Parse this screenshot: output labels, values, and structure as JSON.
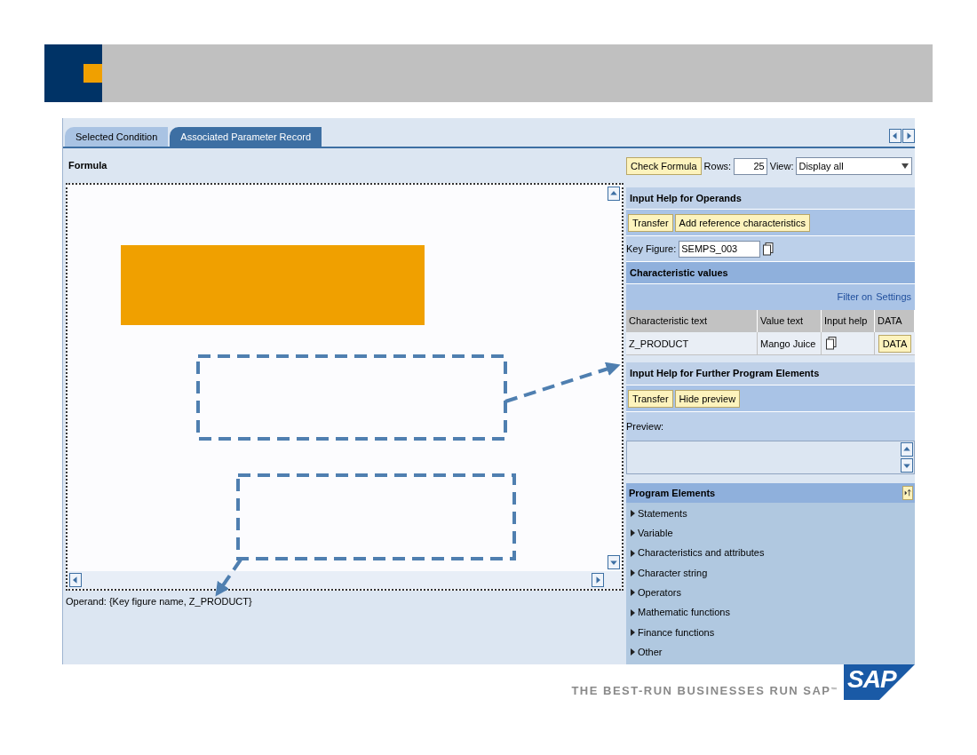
{
  "tabs": [
    {
      "label": "Selected Condition",
      "selected": false
    },
    {
      "label": "Associated Parameter Record",
      "selected": true
    }
  ],
  "formula": {
    "label": "Formula",
    "operand": "Operand: {Key figure name, Z_PRODUCT}"
  },
  "toolbar": {
    "check_button": "Check Formula",
    "rows_label": "Rows:",
    "rows_value": "25",
    "view_label": "View:",
    "view_value": "Display all"
  },
  "operands": {
    "title": "Input Help for Operands",
    "buttons": [
      "Transfer",
      "Add reference characteristics"
    ],
    "key_figure_label": "Key Figure:",
    "key_figure_value": "SEMPS_003"
  },
  "characteristic_values": {
    "title": "Characteristic values",
    "links": [
      "Filter on",
      "Settings"
    ],
    "columns": [
      "Characteristic text",
      "Value text",
      "Input help",
      "DATA"
    ],
    "rows": [
      {
        "characteristic": "Z_PRODUCT",
        "value": "Mango Juice",
        "data_button": "DATA"
      }
    ]
  },
  "program_elements_help": {
    "title": "Input Help for Further Program Elements",
    "buttons": [
      "Transfer",
      "Hide preview"
    ],
    "preview_label": "Preview:"
  },
  "program_elements": {
    "title": "Program Elements",
    "items": [
      {
        "label": "Statements",
        "expanded": false
      },
      {
        "label": "Variable",
        "expanded": false
      },
      {
        "label": "Characteristics and attributes",
        "expanded": false
      },
      {
        "label": "Character string",
        "expanded": false
      },
      {
        "label": "Operators",
        "expanded": false
      },
      {
        "label": "Mathematic functions",
        "expanded": false
      },
      {
        "label": "Finance functions",
        "expanded": false
      },
      {
        "label": "Other",
        "expanded": false
      }
    ]
  },
  "footer": {
    "tagline": "THE BEST-RUN BUSINESSES RUN SAP",
    "trademark": "™",
    "logo": "SAP"
  }
}
